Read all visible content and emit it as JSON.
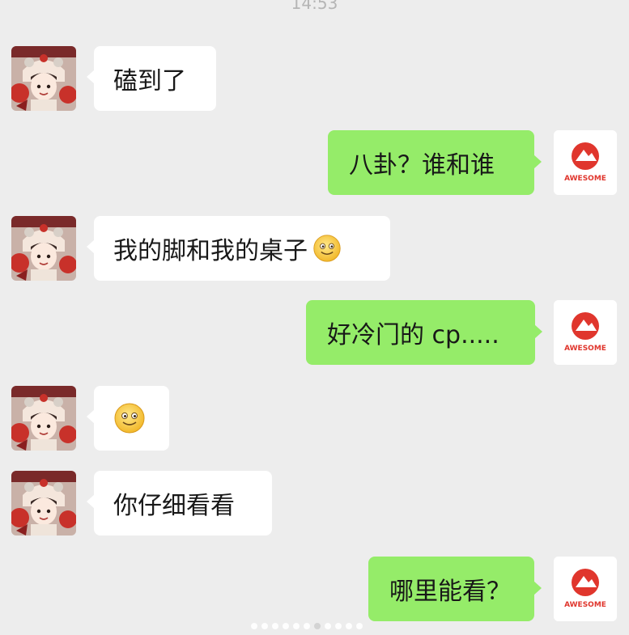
{
  "status": {
    "time": "14:53"
  },
  "contact": {
    "avatar_icon": "girl-avatar-icon"
  },
  "me": {
    "avatar_icon": "awesome-logo-icon",
    "logo_text": "AWESOME"
  },
  "messages": [
    {
      "side": "left",
      "text": "磕到了"
    },
    {
      "side": "right",
      "text": "八卦？谁和谁"
    },
    {
      "side": "left",
      "text": "我的脚和我的桌子",
      "emoji": "smile-emoji-icon"
    },
    {
      "side": "right",
      "text": "好冷门的 cp....."
    },
    {
      "side": "left",
      "text": "",
      "emoji": "smile-emoji-icon"
    },
    {
      "side": "left",
      "text": "你仔细看看"
    },
    {
      "side": "right",
      "text": "哪里能看？"
    }
  ],
  "pager": {
    "count": 11,
    "active_index": 6
  },
  "colors": {
    "background": "#ededed",
    "right_bubble": "#95ec69",
    "left_bubble": "#ffffff",
    "logo_red": "#e0362d"
  }
}
